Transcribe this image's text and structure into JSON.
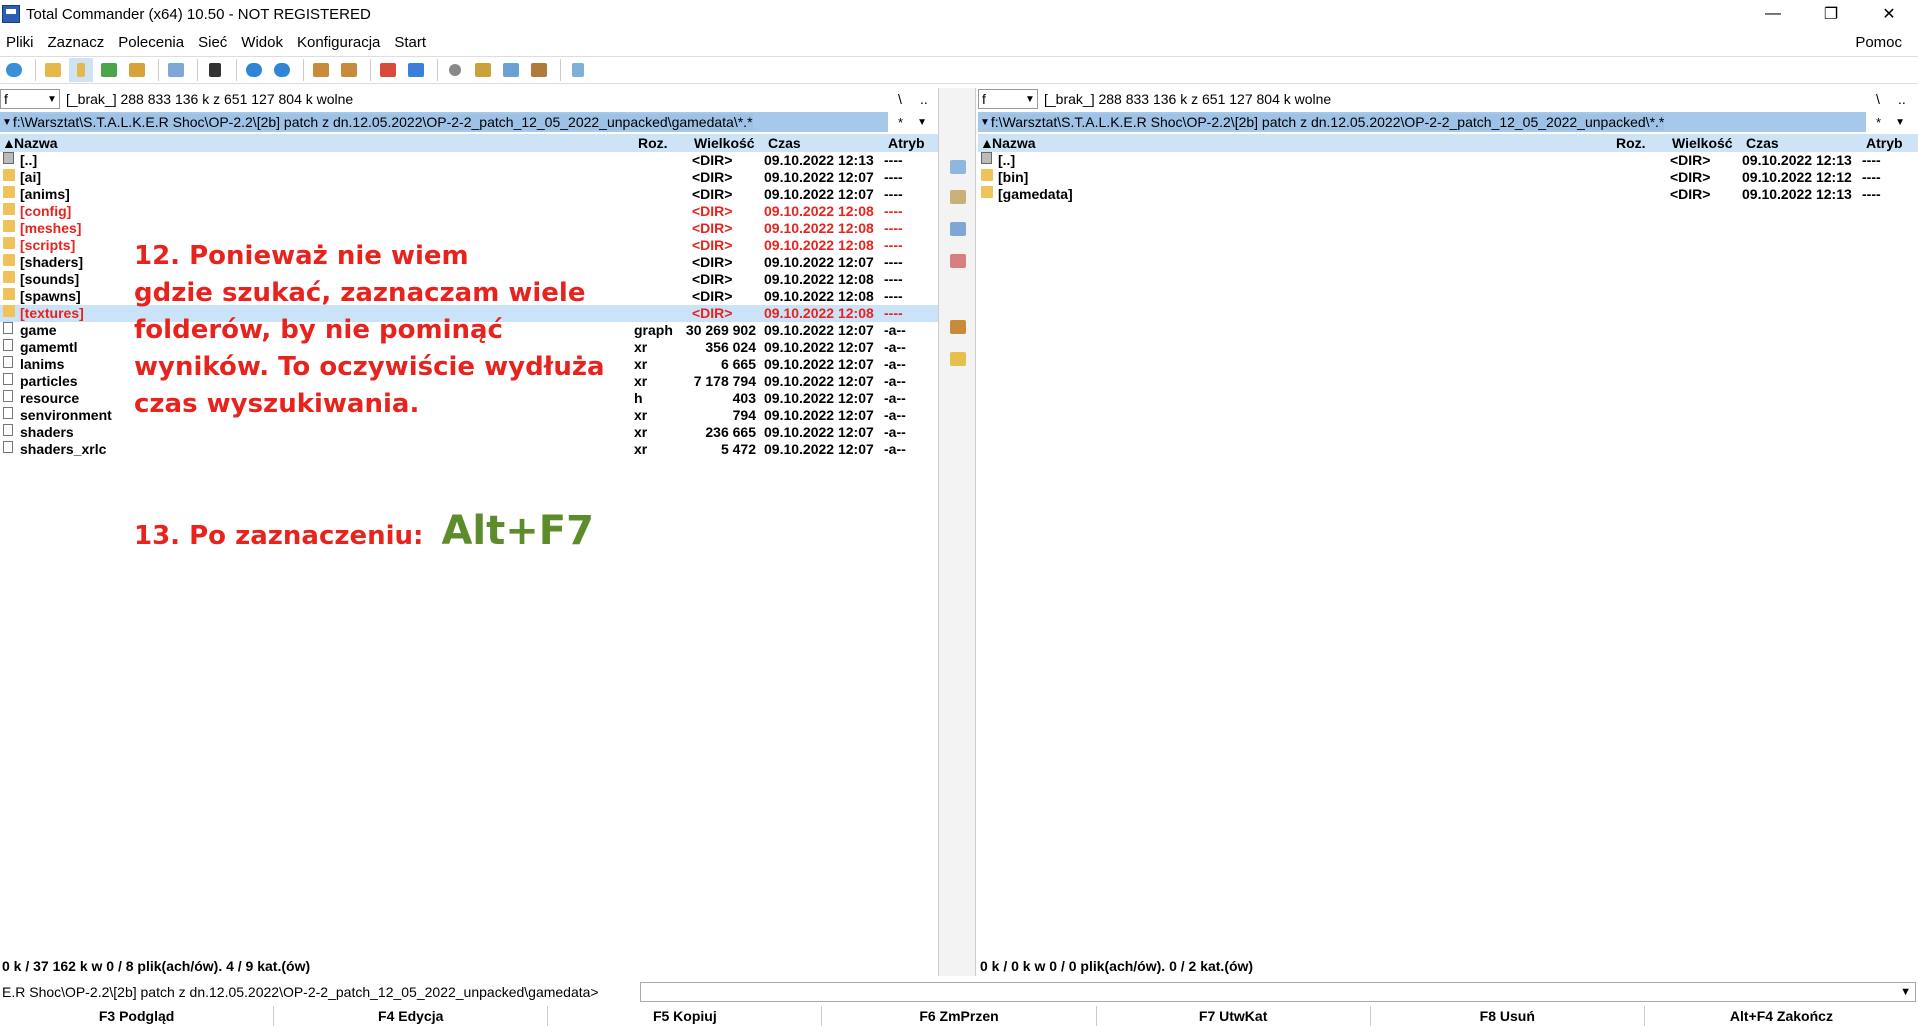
{
  "window": {
    "title": "Total Commander (x64) 10.50 - NOT REGISTERED",
    "minimize": "—",
    "restore": "❐",
    "close": "✕"
  },
  "menu": {
    "items": [
      "Pliki",
      "Zaznacz",
      "Polecenia",
      "Sieć",
      "Widok",
      "Konfiguracja",
      "Start"
    ],
    "help": "Pomoc"
  },
  "left": {
    "drive": "f",
    "drive_info": "[_brak_]  288 833 136 k z 651 127 804 k wolne",
    "root_btn": "\\",
    "up_btn": "..",
    "path": "f:\\Warsztat\\S.T.A.L.K.E.R Shoc\\OP-2.2\\[2b] patch z dn.12.05.2022\\OP-2-2_patch_12_05_2022_unpacked\\gamedata\\*.*",
    "star": "*",
    "columns": {
      "name": "Nazwa",
      "ext": "Roz.",
      "size": "Wielkość",
      "time": "Czas",
      "attr": "Atryb"
    },
    "rows": [
      {
        "icon": "up",
        "name": "[..]",
        "ext": "",
        "size": "<DIR>",
        "time": "09.10.2022 12:13",
        "attr": "----",
        "red": false,
        "sel": false
      },
      {
        "icon": "dir",
        "name": "[ai]",
        "ext": "",
        "size": "<DIR>",
        "time": "09.10.2022 12:07",
        "attr": "----",
        "red": false,
        "sel": false
      },
      {
        "icon": "dir",
        "name": "[anims]",
        "ext": "",
        "size": "<DIR>",
        "time": "09.10.2022 12:07",
        "attr": "----",
        "red": false,
        "sel": false
      },
      {
        "icon": "dir",
        "name": "[config]",
        "ext": "",
        "size": "<DIR>",
        "time": "09.10.2022 12:08",
        "attr": "----",
        "red": true,
        "sel": false
      },
      {
        "icon": "dir",
        "name": "[meshes]",
        "ext": "",
        "size": "<DIR>",
        "time": "09.10.2022 12:08",
        "attr": "----",
        "red": true,
        "sel": false
      },
      {
        "icon": "dir",
        "name": "[scripts]",
        "ext": "",
        "size": "<DIR>",
        "time": "09.10.2022 12:08",
        "attr": "----",
        "red": true,
        "sel": false
      },
      {
        "icon": "dir",
        "name": "[shaders]",
        "ext": "",
        "size": "<DIR>",
        "time": "09.10.2022 12:07",
        "attr": "----",
        "red": false,
        "sel": false
      },
      {
        "icon": "dir",
        "name": "[sounds]",
        "ext": "",
        "size": "<DIR>",
        "time": "09.10.2022 12:08",
        "attr": "----",
        "red": false,
        "sel": false
      },
      {
        "icon": "dir",
        "name": "[spawns]",
        "ext": "",
        "size": "<DIR>",
        "time": "09.10.2022 12:08",
        "attr": "----",
        "red": false,
        "sel": false
      },
      {
        "icon": "dir",
        "name": "[textures]",
        "ext": "",
        "size": "<DIR>",
        "time": "09.10.2022 12:08",
        "attr": "----",
        "red": true,
        "sel": true
      },
      {
        "icon": "file",
        "name": "game",
        "ext": "graph",
        "size": "30 269 902",
        "time": "09.10.2022 12:07",
        "attr": "-a--",
        "red": false,
        "sel": false
      },
      {
        "icon": "file",
        "name": "gamemtl",
        "ext": "xr",
        "size": "356 024",
        "time": "09.10.2022 12:07",
        "attr": "-a--",
        "red": false,
        "sel": false
      },
      {
        "icon": "file",
        "name": "lanims",
        "ext": "xr",
        "size": "6 665",
        "time": "09.10.2022 12:07",
        "attr": "-a--",
        "red": false,
        "sel": false
      },
      {
        "icon": "file",
        "name": "particles",
        "ext": "xr",
        "size": "7 178 794",
        "time": "09.10.2022 12:07",
        "attr": "-a--",
        "red": false,
        "sel": false
      },
      {
        "icon": "file",
        "name": "resource",
        "ext": "h",
        "size": "403",
        "time": "09.10.2022 12:07",
        "attr": "-a--",
        "red": false,
        "sel": false
      },
      {
        "icon": "file",
        "name": "senvironment",
        "ext": "xr",
        "size": "794",
        "time": "09.10.2022 12:07",
        "attr": "-a--",
        "red": false,
        "sel": false
      },
      {
        "icon": "file",
        "name": "shaders",
        "ext": "xr",
        "size": "236 665",
        "time": "09.10.2022 12:07",
        "attr": "-a--",
        "red": false,
        "sel": false
      },
      {
        "icon": "file",
        "name": "shaders_xrlc",
        "ext": "xr",
        "size": "5 472",
        "time": "09.10.2022 12:07",
        "attr": "-a--",
        "red": false,
        "sel": false
      }
    ],
    "status": "0 k / 37 162 k w 0 / 8 plik(ach/ów). 4 / 9 kat.(ów)"
  },
  "right": {
    "drive": "f",
    "drive_info": "[_brak_]  288 833 136 k z 651 127 804 k wolne",
    "root_btn": "\\",
    "up_btn": "..",
    "path": "f:\\Warsztat\\S.T.A.L.K.E.R Shoc\\OP-2.2\\[2b] patch z dn.12.05.2022\\OP-2-2_patch_12_05_2022_unpacked\\*.*",
    "star": "*",
    "columns": {
      "name": "Nazwa",
      "ext": "Roz.",
      "size": "Wielkość",
      "time": "Czas",
      "attr": "Atryb"
    },
    "rows": [
      {
        "icon": "up",
        "name": "[..]",
        "ext": "",
        "size": "<DIR>",
        "time": "09.10.2022 12:13",
        "attr": "----",
        "red": false,
        "sel": false
      },
      {
        "icon": "dir",
        "name": "[bin]",
        "ext": "",
        "size": "<DIR>",
        "time": "09.10.2022 12:12",
        "attr": "----",
        "red": false,
        "sel": false
      },
      {
        "icon": "dir",
        "name": "[gamedata]",
        "ext": "",
        "size": "<DIR>",
        "time": "09.10.2022 12:13",
        "attr": "----",
        "red": false,
        "sel": false
      }
    ],
    "status": "0 k / 0 k w 0 / 0 plik(ach/ów). 0 / 2 kat.(ów)"
  },
  "cmdline": {
    "path": "E.R Shoc\\OP-2.2\\[2b] patch z dn.12.05.2022\\OP-2-2_patch_12_05_2022_unpacked\\gamedata>",
    "value": ""
  },
  "fkeys": [
    "F3 Podgląd",
    "F4 Edycja",
    "F5 Kopiuj",
    "F6 ZmPrzen",
    "F7 UtwKat",
    "F8 Usuń",
    "Alt+F4 Zakończ"
  ],
  "annotations": {
    "note12_lines": [
      "12.  Ponieważ nie wiem",
      "gdzie szukać, zaznaczam wiele",
      "folderów, by nie pominąć",
      "wyników. To oczywiście wydłuża",
      "czas wyszukiwania."
    ],
    "note13_text": "13. Po zaznaczeniu:",
    "note13_key": "Alt+F7"
  },
  "colors": {
    "accent_red": "#e8231d",
    "key_green": "#5d8d2a",
    "selection": "#cbe3f8",
    "path_bg": "#a6c8ea"
  }
}
